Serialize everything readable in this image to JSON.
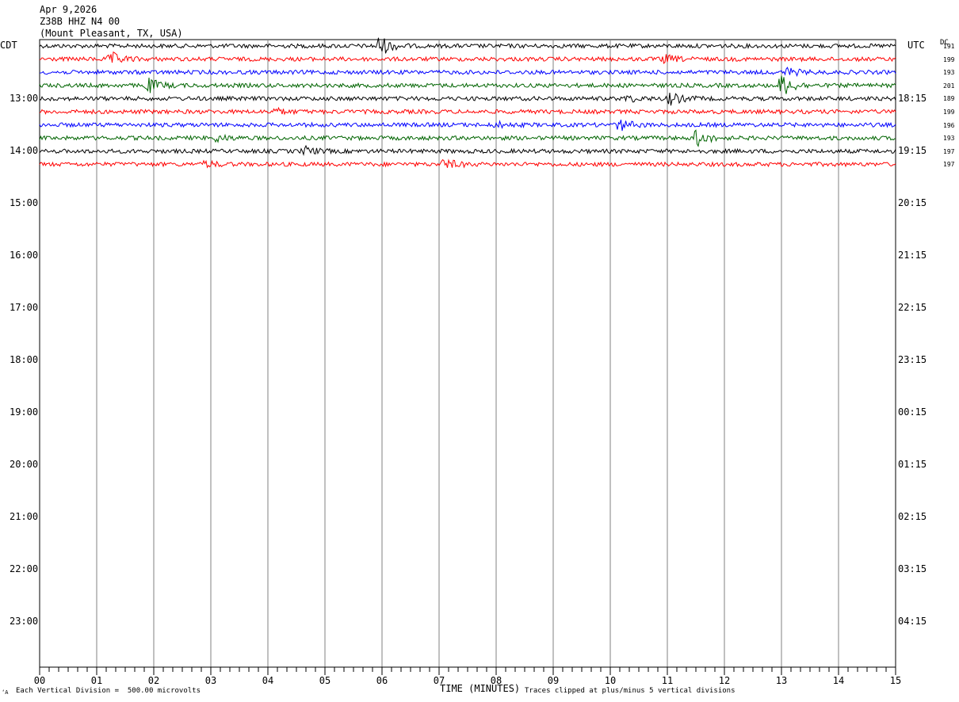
{
  "header": {
    "date": "Apr 9,2026",
    "station": "Z38B HHZ N4 00",
    "location": "(Mount Pleasant, TX, USA)"
  },
  "left_tz": "CDT",
  "right_tz": "UTC",
  "dc_label": "DC",
  "footer": {
    "vertical_division": "Each Vertical Division =  500.00 microvolts",
    "x_title": "TIME (MINUTES)",
    "clip_note": "Traces clipped at plus/minus 5 vertical divisions",
    "corner_mark": "‘A"
  },
  "colors": {
    "grid": "#808080",
    "trace_cycle": [
      "#000000",
      "#ff0000",
      "#0000ff",
      "#006400"
    ]
  },
  "chart_data": {
    "type": "helicorder",
    "x_range_minutes": [
      0,
      15
    ],
    "x_ticks": [
      "00",
      "01",
      "02",
      "03",
      "04",
      "05",
      "06",
      "07",
      "08",
      "09",
      "10",
      "11",
      "12",
      "13",
      "14",
      "15"
    ],
    "hour_labels_left": [
      "13:00",
      "14:00",
      "15:00",
      "16:00",
      "17:00",
      "18:00",
      "19:00",
      "20:00",
      "21:00",
      "22:00",
      "23:00"
    ],
    "hour_labels_right": [
      "18:15",
      "19:15",
      "20:15",
      "21:15",
      "22:15",
      "23:15",
      "00:15",
      "01:15",
      "02:15",
      "03:15",
      "04:15"
    ],
    "trace_count": 10,
    "trace_offsets": [
      "191",
      "199",
      "193",
      "201",
      "189",
      "199",
      "196",
      "193",
      "197",
      "197"
    ],
    "events": [
      {
        "trace": 0,
        "minute": 5.95,
        "strength": 3.2
      },
      {
        "trace": 1,
        "minute": 1.25,
        "strength": 2.0
      },
      {
        "trace": 1,
        "minute": 10.95,
        "strength": 1.2
      },
      {
        "trace": 2,
        "minute": 13.1,
        "strength": 1.2
      },
      {
        "trace": 3,
        "minute": 1.9,
        "strength": 2.2
      },
      {
        "trace": 3,
        "minute": 13.0,
        "strength": 3.5
      },
      {
        "trace": 4,
        "minute": 11.05,
        "strength": 1.8
      },
      {
        "trace": 4,
        "minute": 10.3,
        "strength": 0.9
      },
      {
        "trace": 5,
        "minute": 4.1,
        "strength": 1.0
      },
      {
        "trace": 6,
        "minute": 10.15,
        "strength": 1.8
      },
      {
        "trace": 6,
        "minute": 8.0,
        "strength": 0.8
      },
      {
        "trace": 7,
        "minute": 11.5,
        "strength": 2.5
      },
      {
        "trace": 7,
        "minute": 3.1,
        "strength": 1.0
      },
      {
        "trace": 8,
        "minute": 4.65,
        "strength": 1.3
      },
      {
        "trace": 9,
        "minute": 7.1,
        "strength": 1.6
      },
      {
        "trace": 9,
        "minute": 2.9,
        "strength": 0.9
      }
    ]
  }
}
